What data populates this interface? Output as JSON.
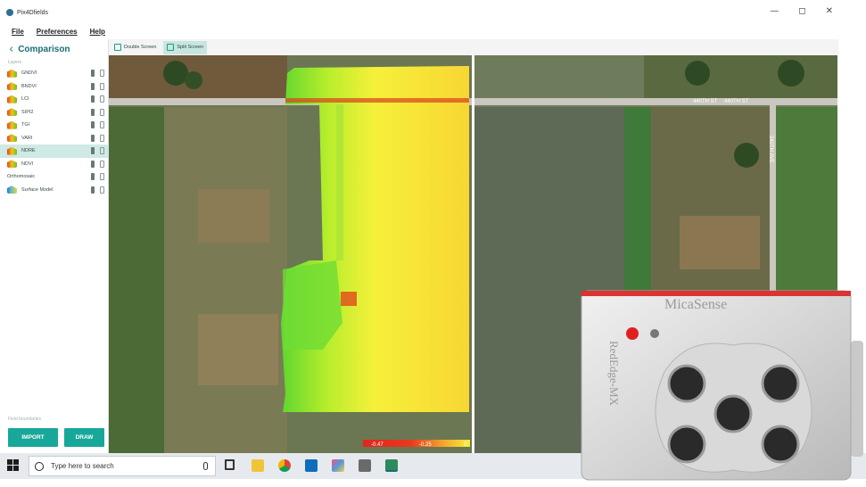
{
  "window": {
    "title": "Pix4Dfields",
    "controls": [
      "—",
      "◻",
      "✕"
    ]
  },
  "menu": [
    "File",
    "Preferences",
    "Help"
  ],
  "sidebar": {
    "back_label": "Comparison",
    "section_layers": "Layers",
    "layers": [
      {
        "name": "GNDVI",
        "active": false,
        "type": "index"
      },
      {
        "name": "BNDVI",
        "active": false,
        "type": "index"
      },
      {
        "name": "LCI",
        "active": false,
        "type": "index"
      },
      {
        "name": "SIPI2",
        "active": false,
        "type": "index"
      },
      {
        "name": "TGI",
        "active": false,
        "type": "index"
      },
      {
        "name": "VARI",
        "active": false,
        "type": "index"
      },
      {
        "name": "NDRE",
        "active": true,
        "type": "index"
      },
      {
        "name": "NDVI",
        "active": false,
        "type": "index"
      }
    ],
    "section_ortho": "Orthomosaic",
    "surface_label": "Surface Model",
    "field_boundaries": "Field boundaries",
    "import_label": "IMPORT",
    "draw_label": "DRAW"
  },
  "toolbar": {
    "double_screen": "Double Screen",
    "split_screen": "Split Screen"
  },
  "map": {
    "road_label_1": "440TH ST",
    "road_label_2": "440TH ST",
    "road_label_v": "240TH AVE",
    "legend_min": "-0.47",
    "legend_mid": "-0.25",
    "legend_max": "0"
  },
  "taskbar": {
    "search_placeholder": "Type here to search",
    "apps": [
      "task-view-icon",
      "file-explorer-icon",
      "chrome-icon",
      "outlook-icon",
      "paint-icon",
      "calculator-icon",
      "pix4d-icon"
    ]
  },
  "camera": {
    "brand": "MicaSense",
    "model": "RedEdge-MX"
  },
  "colors": {
    "accent": "#17a89a",
    "active_row": "#cfe9e4",
    "header_text": "#1a6d73"
  }
}
